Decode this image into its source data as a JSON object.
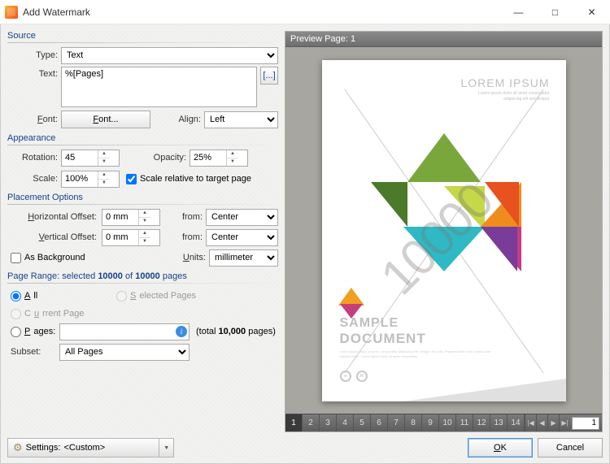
{
  "window": {
    "title": "Add Watermark"
  },
  "source": {
    "heading": "Source",
    "type_label": "Type:",
    "type_value": "Text",
    "text_label": "Text:",
    "text_value": "%[Pages]",
    "macro_btn": "[...]",
    "font_label": "Font:",
    "font_btn": "Font...",
    "align_label": "Align:",
    "align_value": "Left"
  },
  "appearance": {
    "heading": "Appearance",
    "rotation_label": "Rotation:",
    "rotation_value": "45",
    "opacity_label": "Opacity:",
    "opacity_value": "25%",
    "scale_label": "Scale:",
    "scale_value": "100%",
    "scale_relative_label": "Scale relative to target page",
    "scale_relative_checked": true
  },
  "placement": {
    "heading": "Placement Options",
    "hoff_label": "Horizontal Offset:",
    "hoff_value": "0 mm",
    "voff_label": "Vertical Offset:",
    "voff_value": "0 mm",
    "from_label": "from:",
    "hfrom_value": "Center",
    "vfrom_value": "Center",
    "asbg_label": "As Background",
    "asbg_checked": false,
    "units_label": "Units:",
    "units_value": "millimeter"
  },
  "range": {
    "heading": "Page Range: selected 10000 of 10000 pages",
    "all": "All",
    "selected_pages": "Selected Pages",
    "current_page": "Current Page",
    "pages": "Pages:",
    "pages_value": "",
    "total_label": "(total 10,000 pages)",
    "subset_label": "Subset:",
    "subset_value": "All Pages",
    "checked": "all"
  },
  "preview": {
    "heading": "Preview Page: 1",
    "lorem_title": "LOREM IPSUM",
    "sample1": "SAMPLE",
    "sample2": "DOCUMENT",
    "watermark_text": "10000",
    "pages": [
      "1",
      "2",
      "3",
      "4",
      "5",
      "6",
      "7",
      "8",
      "9",
      "10",
      "11",
      "12",
      "13",
      "14"
    ],
    "page_input": "1"
  },
  "footer": {
    "settings_label": "Settings:",
    "settings_value": "<Custom>",
    "ok": "OK",
    "cancel": "Cancel"
  }
}
